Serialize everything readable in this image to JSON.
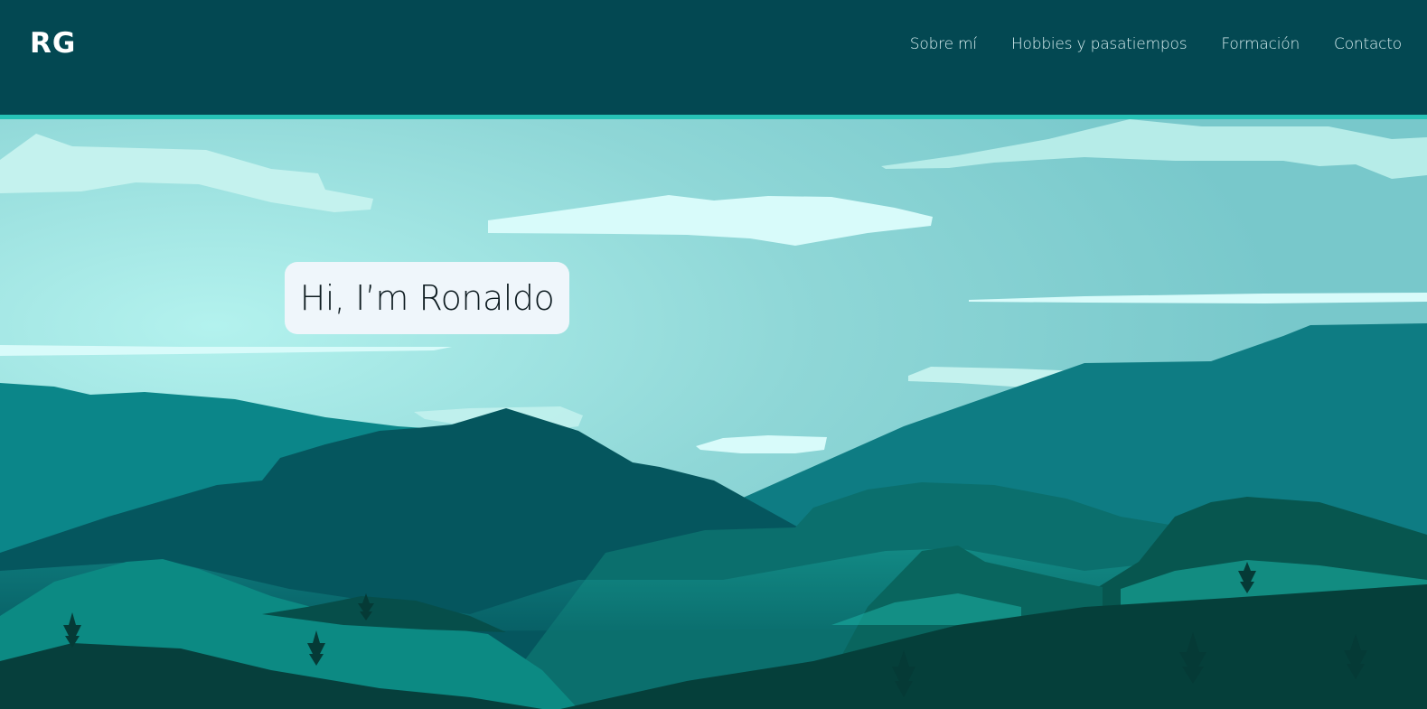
{
  "brand": {
    "label": "RG"
  },
  "nav": {
    "items": [
      {
        "label": "Sobre mí"
      },
      {
        "label": "Hobbies y pasatiempos"
      },
      {
        "label": "Formación"
      },
      {
        "label": "Contacto"
      }
    ]
  },
  "hero": {
    "greeting": "Hi, I’m Ronaldo",
    "scene": "mountain-landscape-illustration"
  },
  "colors": {
    "navbar": "#034852",
    "accent": "#27c2b6",
    "greeting_bg": "#eff6fb"
  }
}
